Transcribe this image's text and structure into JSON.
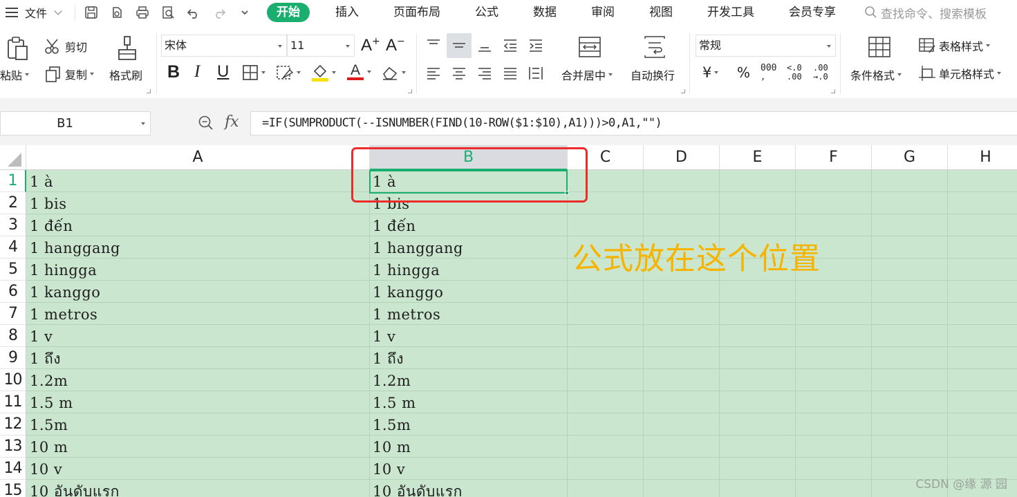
{
  "menu": {
    "file_label": "文件",
    "tabs": [
      "开始",
      "插入",
      "页面布局",
      "公式",
      "数据",
      "审阅",
      "视图",
      "开发工具",
      "会员专享"
    ],
    "search_placeholder": "查找命令、搜索模板"
  },
  "ribbon": {
    "paste_label": "粘贴",
    "cut_label": "剪切",
    "copy_label": "复制",
    "format_painter_label": "格式刷",
    "font_name": "宋体",
    "font_size": "11",
    "merge_center_label": "合并居中",
    "wrap_text_label": "自动换行",
    "number_format": "常规",
    "currency_symbol": "¥",
    "percent_symbol": "%",
    "thousands_symbol": "000",
    "conditional_format_label": "条件格式",
    "table_style_label": "表格样式",
    "cell_style_label": "单元格样式"
  },
  "formula_bar": {
    "name_box": "B1",
    "fx_label": "fx",
    "formula": "=IF(SUMPRODUCT(--ISNUMBER(FIND(10-ROW($1:$10),A1)))>0,A1,\"\")"
  },
  "grid": {
    "columns": [
      "A",
      "B",
      "C",
      "D",
      "E",
      "F",
      "G",
      "H"
    ],
    "selected_column": "B",
    "selected_row": "1",
    "rows": [
      {
        "num": "1",
        "a": "1 à",
        "b": "1 à"
      },
      {
        "num": "2",
        "a": "1 bis",
        "b": "1 bis"
      },
      {
        "num": "3",
        "a": "1 đến",
        "b": "1 đến"
      },
      {
        "num": "4",
        "a": "1 hanggang",
        "b": "1 hanggang"
      },
      {
        "num": "5",
        "a": "1 hingga",
        "b": "1 hingga"
      },
      {
        "num": "6",
        "a": "1 kanggo",
        "b": "1 kanggo"
      },
      {
        "num": "7",
        "a": "1 metros",
        "b": "1 metros"
      },
      {
        "num": "8",
        "a": "1 v",
        "b": "1 v"
      },
      {
        "num": "9",
        "a": "1 ถึง",
        "b": "1 ถึง"
      },
      {
        "num": "10",
        "a": "1.2m",
        "b": "1.2m"
      },
      {
        "num": "11",
        "a": "1.5 m",
        "b": "1.5 m"
      },
      {
        "num": "12",
        "a": "1.5m",
        "b": "1.5m"
      },
      {
        "num": "13",
        "a": "10 m",
        "b": "10 m"
      },
      {
        "num": "14",
        "a": "10 v",
        "b": "10 v"
      },
      {
        "num": "15",
        "a": "10 อันดับแรก",
        "b": "10 อันดับแรก"
      }
    ]
  },
  "annotation": "公式放在这个位置",
  "watermark": "CSDN @缘 源 园",
  "colors": {
    "accent": "#1aae6f",
    "cell_fill": "#cbe6cf",
    "highlight_box": "#ee2b2b",
    "annotation_text": "#f6b400"
  }
}
